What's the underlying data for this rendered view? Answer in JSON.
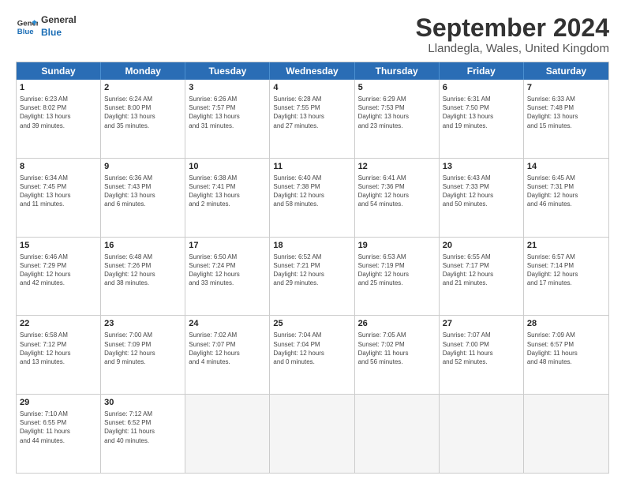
{
  "header": {
    "logo_line1": "General",
    "logo_line2": "Blue",
    "main_title": "September 2024",
    "subtitle": "Llandegla, Wales, United Kingdom"
  },
  "days_of_week": [
    "Sunday",
    "Monday",
    "Tuesday",
    "Wednesday",
    "Thursday",
    "Friday",
    "Saturday"
  ],
  "weeks": [
    [
      {
        "day": 1,
        "lines": [
          "Sunrise: 6:23 AM",
          "Sunset: 8:02 PM",
          "Daylight: 13 hours",
          "and 39 minutes."
        ]
      },
      {
        "day": 2,
        "lines": [
          "Sunrise: 6:24 AM",
          "Sunset: 8:00 PM",
          "Daylight: 13 hours",
          "and 35 minutes."
        ]
      },
      {
        "day": 3,
        "lines": [
          "Sunrise: 6:26 AM",
          "Sunset: 7:57 PM",
          "Daylight: 13 hours",
          "and 31 minutes."
        ]
      },
      {
        "day": 4,
        "lines": [
          "Sunrise: 6:28 AM",
          "Sunset: 7:55 PM",
          "Daylight: 13 hours",
          "and 27 minutes."
        ]
      },
      {
        "day": 5,
        "lines": [
          "Sunrise: 6:29 AM",
          "Sunset: 7:53 PM",
          "Daylight: 13 hours",
          "and 23 minutes."
        ]
      },
      {
        "day": 6,
        "lines": [
          "Sunrise: 6:31 AM",
          "Sunset: 7:50 PM",
          "Daylight: 13 hours",
          "and 19 minutes."
        ]
      },
      {
        "day": 7,
        "lines": [
          "Sunrise: 6:33 AM",
          "Sunset: 7:48 PM",
          "Daylight: 13 hours",
          "and 15 minutes."
        ]
      }
    ],
    [
      {
        "day": 8,
        "lines": [
          "Sunrise: 6:34 AM",
          "Sunset: 7:45 PM",
          "Daylight: 13 hours",
          "and 11 minutes."
        ]
      },
      {
        "day": 9,
        "lines": [
          "Sunrise: 6:36 AM",
          "Sunset: 7:43 PM",
          "Daylight: 13 hours",
          "and 6 minutes."
        ]
      },
      {
        "day": 10,
        "lines": [
          "Sunrise: 6:38 AM",
          "Sunset: 7:41 PM",
          "Daylight: 13 hours",
          "and 2 minutes."
        ]
      },
      {
        "day": 11,
        "lines": [
          "Sunrise: 6:40 AM",
          "Sunset: 7:38 PM",
          "Daylight: 12 hours",
          "and 58 minutes."
        ]
      },
      {
        "day": 12,
        "lines": [
          "Sunrise: 6:41 AM",
          "Sunset: 7:36 PM",
          "Daylight: 12 hours",
          "and 54 minutes."
        ]
      },
      {
        "day": 13,
        "lines": [
          "Sunrise: 6:43 AM",
          "Sunset: 7:33 PM",
          "Daylight: 12 hours",
          "and 50 minutes."
        ]
      },
      {
        "day": 14,
        "lines": [
          "Sunrise: 6:45 AM",
          "Sunset: 7:31 PM",
          "Daylight: 12 hours",
          "and 46 minutes."
        ]
      }
    ],
    [
      {
        "day": 15,
        "lines": [
          "Sunrise: 6:46 AM",
          "Sunset: 7:29 PM",
          "Daylight: 12 hours",
          "and 42 minutes."
        ]
      },
      {
        "day": 16,
        "lines": [
          "Sunrise: 6:48 AM",
          "Sunset: 7:26 PM",
          "Daylight: 12 hours",
          "and 38 minutes."
        ]
      },
      {
        "day": 17,
        "lines": [
          "Sunrise: 6:50 AM",
          "Sunset: 7:24 PM",
          "Daylight: 12 hours",
          "and 33 minutes."
        ]
      },
      {
        "day": 18,
        "lines": [
          "Sunrise: 6:52 AM",
          "Sunset: 7:21 PM",
          "Daylight: 12 hours",
          "and 29 minutes."
        ]
      },
      {
        "day": 19,
        "lines": [
          "Sunrise: 6:53 AM",
          "Sunset: 7:19 PM",
          "Daylight: 12 hours",
          "and 25 minutes."
        ]
      },
      {
        "day": 20,
        "lines": [
          "Sunrise: 6:55 AM",
          "Sunset: 7:17 PM",
          "Daylight: 12 hours",
          "and 21 minutes."
        ]
      },
      {
        "day": 21,
        "lines": [
          "Sunrise: 6:57 AM",
          "Sunset: 7:14 PM",
          "Daylight: 12 hours",
          "and 17 minutes."
        ]
      }
    ],
    [
      {
        "day": 22,
        "lines": [
          "Sunrise: 6:58 AM",
          "Sunset: 7:12 PM",
          "Daylight: 12 hours",
          "and 13 minutes."
        ]
      },
      {
        "day": 23,
        "lines": [
          "Sunrise: 7:00 AM",
          "Sunset: 7:09 PM",
          "Daylight: 12 hours",
          "and 9 minutes."
        ]
      },
      {
        "day": 24,
        "lines": [
          "Sunrise: 7:02 AM",
          "Sunset: 7:07 PM",
          "Daylight: 12 hours",
          "and 4 minutes."
        ]
      },
      {
        "day": 25,
        "lines": [
          "Sunrise: 7:04 AM",
          "Sunset: 7:04 PM",
          "Daylight: 12 hours",
          "and 0 minutes."
        ]
      },
      {
        "day": 26,
        "lines": [
          "Sunrise: 7:05 AM",
          "Sunset: 7:02 PM",
          "Daylight: 11 hours",
          "and 56 minutes."
        ]
      },
      {
        "day": 27,
        "lines": [
          "Sunrise: 7:07 AM",
          "Sunset: 7:00 PM",
          "Daylight: 11 hours",
          "and 52 minutes."
        ]
      },
      {
        "day": 28,
        "lines": [
          "Sunrise: 7:09 AM",
          "Sunset: 6:57 PM",
          "Daylight: 11 hours",
          "and 48 minutes."
        ]
      }
    ],
    [
      {
        "day": 29,
        "lines": [
          "Sunrise: 7:10 AM",
          "Sunset: 6:55 PM",
          "Daylight: 11 hours",
          "and 44 minutes."
        ]
      },
      {
        "day": 30,
        "lines": [
          "Sunrise: 7:12 AM",
          "Sunset: 6:52 PM",
          "Daylight: 11 hours",
          "and 40 minutes."
        ]
      },
      null,
      null,
      null,
      null,
      null
    ]
  ]
}
